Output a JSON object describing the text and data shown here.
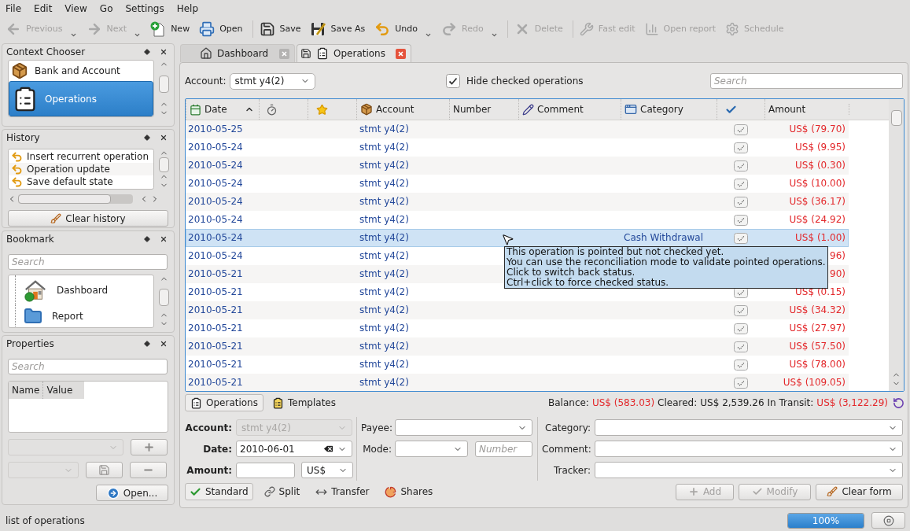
{
  "menu": [
    "File",
    "Edit",
    "View",
    "Go",
    "Settings",
    "Help"
  ],
  "toolbar": [
    [
      {
        "label": "Previous",
        "disabled": true,
        "dropdown": true
      },
      {
        "label": "Next",
        "disabled": true,
        "dropdown": true
      },
      {
        "label": "New",
        "disabled": false,
        "dropdown": false
      },
      {
        "label": "Open",
        "disabled": false,
        "dropdown": false
      }
    ],
    [
      {
        "label": "Save",
        "disabled": false,
        "dropdown": false
      },
      {
        "label": "Save As",
        "disabled": false,
        "dropdown": false
      },
      {
        "label": "Undo",
        "disabled": false,
        "dropdown": true
      },
      {
        "label": "Redo",
        "disabled": true,
        "dropdown": true
      }
    ],
    [
      {
        "label": "Delete",
        "disabled": true,
        "dropdown": false
      }
    ],
    [
      {
        "label": "Fast edit",
        "disabled": true,
        "dropdown": false
      },
      {
        "label": "Open report",
        "disabled": true,
        "dropdown": false
      },
      {
        "label": "Schedule",
        "disabled": true,
        "dropdown": false
      }
    ]
  ],
  "context_chooser": {
    "title": "Context Chooser",
    "items": [
      {
        "label": "Bank and Account",
        "selected": false
      },
      {
        "label": "Operations",
        "selected": true
      }
    ]
  },
  "history": {
    "title": "History",
    "items": [
      "Insert recurrent operation",
      "Operation update",
      "Save default state"
    ],
    "button": "Clear history"
  },
  "bookmark": {
    "title": "Bookmark",
    "search": {
      "placeholder": "Search"
    },
    "items": [
      "Dashboard",
      "Report"
    ]
  },
  "properties": {
    "title": "Properties",
    "search": {
      "placeholder": "Search"
    },
    "columns": [
      "Name",
      "Value"
    ],
    "button": "Open..."
  },
  "tabs": [
    {
      "label": "Dashboard",
      "selected": false,
      "modified": false
    },
    {
      "label": "Operations",
      "selected": true,
      "modified": true
    }
  ],
  "filter": {
    "account_label": "Account:",
    "account": "stmt y4(2)",
    "hide_checked": {
      "label": "Hide checked operations",
      "checked": true
    },
    "search": {
      "placeholder": "Search"
    }
  },
  "table": {
    "columns": [
      {
        "label": "Date",
        "sorted": true
      },
      {
        "label": "Account",
        "sorted": false
      },
      {
        "label": "Number",
        "sorted": false
      },
      {
        "label": "Comment",
        "sorted": false
      },
      {
        "label": "Category",
        "sorted": false
      },
      {
        "label": "Amount",
        "sorted": false
      }
    ],
    "rows": [
      {
        "date": "2010-05-25",
        "account": "stmt y4(2)",
        "pointed": true,
        "amount": "US$ (79.70)",
        "negative": true,
        "selected": false
      },
      {
        "date": "2010-05-24",
        "account": "stmt y4(2)",
        "pointed": true,
        "amount": "US$ (9.95)",
        "negative": true,
        "selected": false
      },
      {
        "date": "2010-05-24",
        "account": "stmt y4(2)",
        "pointed": true,
        "amount": "US$ (0.30)",
        "negative": true,
        "selected": false
      },
      {
        "date": "2010-05-24",
        "account": "stmt y4(2)",
        "pointed": true,
        "amount": "US$ (10.00)",
        "negative": true,
        "selected": false
      },
      {
        "date": "2010-05-24",
        "account": "stmt y4(2)",
        "pointed": true,
        "amount": "US$ (36.17)",
        "negative": true,
        "selected": false
      },
      {
        "date": "2010-05-24",
        "account": "stmt y4(2)",
        "pointed": true,
        "amount": "US$ (24.92)",
        "negative": true,
        "selected": false
      },
      {
        "date": "2010-05-24",
        "account": "stmt y4(2)",
        "category": "Cash Withdrawal",
        "pointed": true,
        "amount": "US$ (1.00)",
        "negative": true,
        "selected": true
      },
      {
        "date": "2010-05-24",
        "account": "stmt y4(2)",
        "amount": "96)",
        "negative": true,
        "selected": false
      },
      {
        "date": "2010-05-21",
        "account": "stmt y4(2)",
        "amount": "90)",
        "negative": true,
        "selected": false
      },
      {
        "date": "2010-05-21",
        "account": "stmt y4(2)",
        "pointed": true,
        "amount": "US$ (0.15)",
        "negative": true,
        "selected": false
      },
      {
        "date": "2010-05-21",
        "account": "stmt y4(2)",
        "pointed": true,
        "amount": "US$ (34.32)",
        "negative": true,
        "selected": false
      },
      {
        "date": "2010-05-21",
        "account": "stmt y4(2)",
        "pointed": true,
        "amount": "US$ (27.97)",
        "negative": true,
        "selected": false
      },
      {
        "date": "2010-05-21",
        "account": "stmt y4(2)",
        "pointed": true,
        "amount": "US$ (57.50)",
        "negative": true,
        "selected": false
      },
      {
        "date": "2010-05-21",
        "account": "stmt y4(2)",
        "pointed": true,
        "amount": "US$ (78.00)",
        "negative": true,
        "selected": false
      },
      {
        "date": "2010-05-21",
        "account": "stmt y4(2)",
        "pointed": true,
        "amount": "US$ (109.05)",
        "negative": true,
        "selected": false
      }
    ],
    "tooltip": {
      "lines": [
        "This operation is pointed but not checked yet.",
        "You can use the reconciliation mode to validate pointed operations.",
        "Click to switch back status.",
        "Ctrl+click to force checked status."
      ]
    }
  },
  "bottom_tabs": [
    {
      "label": "Operations",
      "selected": true
    },
    {
      "label": "Templates",
      "selected": false
    }
  ],
  "balance": [
    {
      "label": "Balance:",
      "value": "US$ (583.03)",
      "negative": true
    },
    {
      "label": "Cleared:",
      "value": "US$ 2,539.26",
      "negative": false
    },
    {
      "label": "In Transit:",
      "value": "US$ (3,122.29)",
      "negative": true
    }
  ],
  "form": {
    "account": {
      "label": "Account:",
      "value": "stmt y4(2)",
      "disabled": true,
      "required": true
    },
    "date": {
      "label": "Date:",
      "value": "2010-06-01",
      "required": true
    },
    "amount": {
      "label": "Amount:",
      "unit": "US$",
      "required": true
    },
    "payee": {
      "label": "Payee:"
    },
    "mode": {
      "label": "Mode:"
    },
    "number": {
      "placeholder": "Number"
    },
    "category": {
      "label": "Category:"
    },
    "comment": {
      "label": "Comment:"
    },
    "tracker": {
      "label": "Tracker:"
    }
  },
  "modes": [
    {
      "label": "Standard",
      "selected": true
    },
    {
      "label": "Split",
      "selected": false
    },
    {
      "label": "Transfer",
      "selected": false
    },
    {
      "label": "Shares",
      "selected": false
    }
  ],
  "actions": [
    {
      "label": "Add",
      "disabled": true
    },
    {
      "label": "Modify",
      "disabled": true
    },
    {
      "label": "Clear form",
      "disabled": false
    }
  ],
  "status_bar": {
    "message": "list of operations",
    "progress": {
      "level": 1,
      "reading": "100%"
    }
  }
}
